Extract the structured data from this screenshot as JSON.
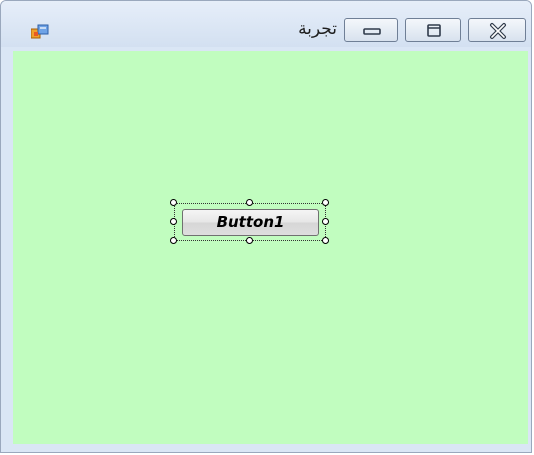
{
  "window": {
    "title": "تجربة",
    "icons": {
      "app": "form-app-icon",
      "minimize": "minimize-icon",
      "maximize": "maximize-icon",
      "close": "close-icon"
    }
  },
  "form": {
    "background": "#c1fdbf",
    "button1": {
      "label": "Button1",
      "selected": true
    }
  }
}
